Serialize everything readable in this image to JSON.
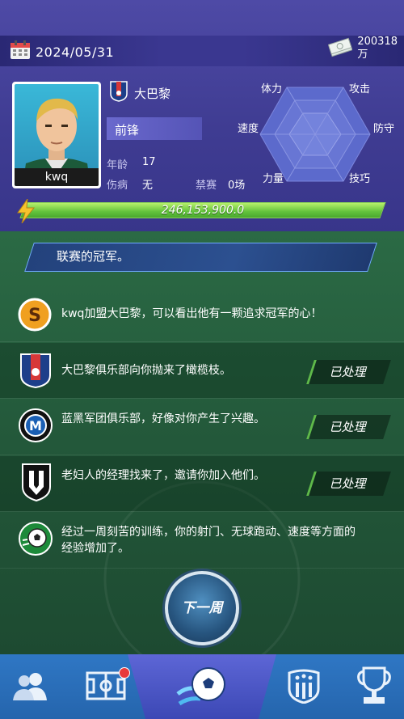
{
  "header": {
    "date": "2024/05/31",
    "money_amount": "200318",
    "money_unit": "万"
  },
  "player": {
    "name": "kwq",
    "club": "大巴黎",
    "position": "前锋",
    "age_label": "年龄",
    "age": "17",
    "injury_label": "伤病",
    "injury": "无",
    "ban_label": "禁赛",
    "ban": "0场"
  },
  "radar": {
    "labels": [
      "体力",
      "攻击",
      "防守",
      "技巧",
      "力量",
      "速度"
    ]
  },
  "xp": {
    "value": "246,153,900.0",
    "fill_fraction": 1.0
  },
  "banner": {
    "text": "联赛的冠军。"
  },
  "events": [
    {
      "text": "kwq加盟大巴黎，可以看出他有一颗追求冠军的心！",
      "icon": "s-logo-icon",
      "status": ""
    },
    {
      "text": "大巴黎俱乐部向你抛来了橄榄枝。",
      "icon": "psg-crest-icon",
      "status": "已处理"
    },
    {
      "text": "蓝黑军团俱乐部，好像对你产生了兴趣。",
      "icon": "inter-crest-icon",
      "status": "已处理"
    },
    {
      "text": "老妇人的经理找来了，邀请你加入他们。",
      "icon": "juve-crest-icon",
      "status": "已处理"
    },
    {
      "text": "经过一周刻苦的训练，你的射门、无球跑动、速度等方面的经验增加了。",
      "icon": "football-icon",
      "status": ""
    }
  ],
  "next_week_button": "下一周",
  "nav": {
    "items": [
      "players-icon",
      "tactics-board-icon",
      "match-ball-icon",
      "club-badge-icon",
      "trophy-icon"
    ],
    "active": "match-ball-icon",
    "notification_on": "tactics-board-icon"
  },
  "colors": {
    "header_bg": "#4e4aa6",
    "pitch": "#23583a",
    "nav": "#2f77c4",
    "xp_fill": "#62c23c"
  }
}
